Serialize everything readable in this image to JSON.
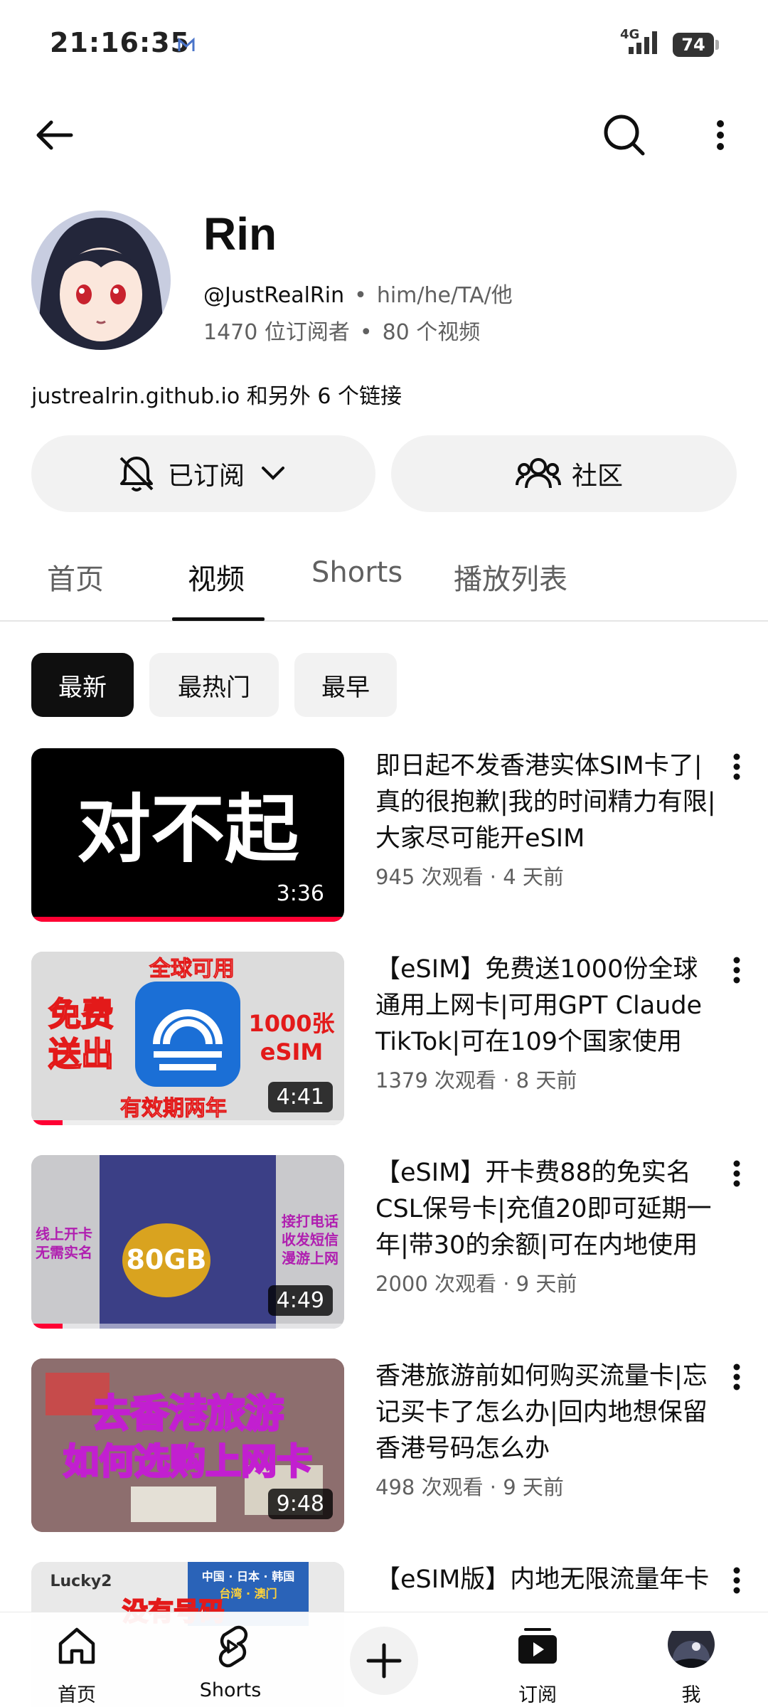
{
  "status_bar": {
    "time": "21:16:35",
    "network": "4G",
    "battery": "74"
  },
  "channel": {
    "name": "Rin",
    "handle": "@JustRealRin",
    "pronouns": "him/he/TA/他",
    "subscribers": "1470 位订阅者",
    "video_count": "80 个视频",
    "links": "justrealrin.github.io 和另外 6 个链接"
  },
  "actions": {
    "subscribed_label": "已订阅",
    "community_label": "社区"
  },
  "tabs": [
    {
      "label": "首页",
      "active": false
    },
    {
      "label": "视频",
      "active": true
    },
    {
      "label": "Shorts",
      "active": false
    },
    {
      "label": "播放列表",
      "active": false
    }
  ],
  "chips": [
    {
      "label": "最新",
      "active": true
    },
    {
      "label": "最热门",
      "active": false
    },
    {
      "label": "最早",
      "active": false
    }
  ],
  "videos": [
    {
      "title": "即日起不发香港实体SIM卡了|真的很抱歉|我的时间精力有限|大家尽可能开eSIM",
      "meta": "945 次观看 · 4 天前",
      "duration": "3:36",
      "thumb_text": "对不起",
      "watched_fraction": 1.0
    },
    {
      "title": "【eSIM】免费送1000份全球通用上网卡|可用GPT Claude TikTok|可在109个国家使用",
      "meta": "1379 次观看 · 8 天前",
      "duration": "4:41",
      "thumb_texts": [
        "全球可用",
        "免费",
        "送出",
        "1000张",
        "eSIM",
        "有效期两年"
      ],
      "watched_fraction": 0.1
    },
    {
      "title": "【eSIM】开卡费88的免实名CSL保号卡|充值20即可延期一年|带30的余额|可在内地使用",
      "meta": "2000 次观看 · 9 天前",
      "duration": "4:49",
      "thumb_texts": [
        "线上开卡",
        "无需实名",
        "80GB",
        "接打电话",
        "收发短信",
        "漫游上网"
      ],
      "watched_fraction": 0.1
    },
    {
      "title": "香港旅游前如何购买流量卡|忘记买卡了怎么办|回内地想保留香港号码怎么办",
      "meta": "498 次观看 · 9 天前",
      "duration": "9:48",
      "thumb_texts": [
        "去香港旅游",
        "如何选购上网卡"
      ],
      "watched_fraction": 0
    },
    {
      "title": "【eSIM版】内地无限流量年卡",
      "meta": "",
      "duration": "",
      "thumb_texts": [
        "Lucky2",
        "中国 · 日本 · 韩国",
        "台湾 · 澳门",
        "没有号码"
      ],
      "watched_fraction": 0
    }
  ],
  "bottom_nav": [
    {
      "label": "首页",
      "icon": "home-icon"
    },
    {
      "label": "Shorts",
      "icon": "shorts-icon"
    },
    {
      "label": "",
      "icon": "create-icon"
    },
    {
      "label": "订阅",
      "icon": "subscriptions-icon"
    },
    {
      "label": "我",
      "icon": "profile-icon"
    }
  ],
  "colors": {
    "accent_red": "#ff0033",
    "chip_active_bg": "#0f0f0f",
    "pill_bg": "#f2f2f2",
    "secondary_text": "#606060"
  }
}
